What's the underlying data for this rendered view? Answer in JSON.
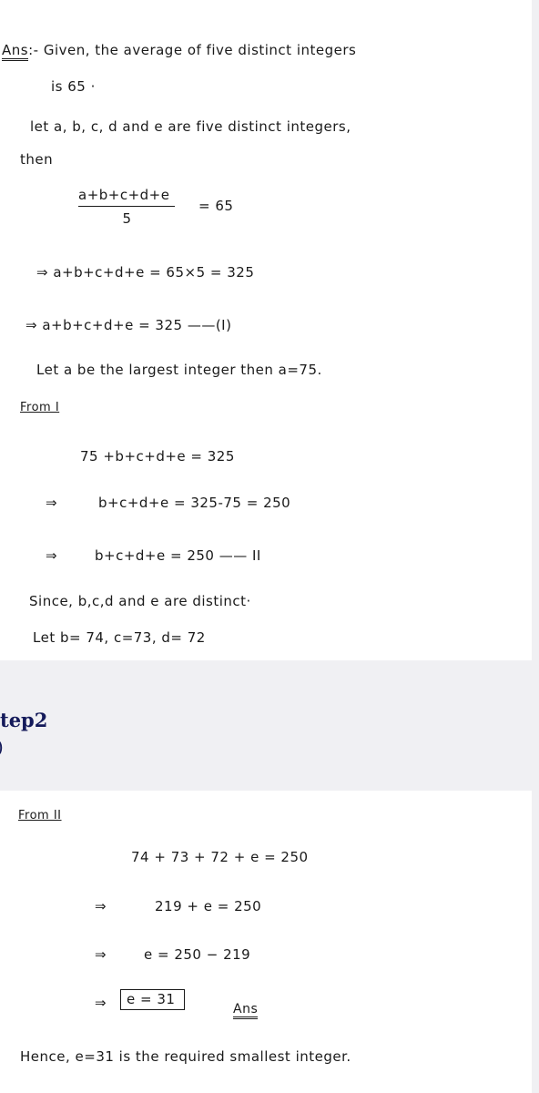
{
  "step_header": {
    "label": "tep2",
    "paren": ")"
  },
  "card1": {
    "ans_label": "Ans",
    "line1": ":- Given, the average of five distinct integers",
    "line2": "is 65 ·",
    "line3": "let a, b, c, d and e are five distinct integers,",
    "line4": "then",
    "fraction": {
      "numerator": "a+b+c+d+e",
      "denominator": "5",
      "rhs": "= 65"
    },
    "eq1": "⇒ a+b+c+d+e = 65×5 = 325",
    "eq2": "⇒ a+b+c+d+e = 325 ——(I)",
    "line5": "Let a be the largest integer then a=75.",
    "from_label": "From I",
    "eq3": "75 +b+c+d+e = 325",
    "eq4_arrow": "⇒",
    "eq4": "b+c+d+e = 325-75 = 250",
    "eq5_arrow": "⇒",
    "eq5": "b+c+d+e = 250 —— II",
    "line6": "Since, b,c,d and e are distinct·",
    "line7": "Let  b= 74, c=73, d= 72"
  },
  "card2": {
    "from_label": "From II",
    "eq1": "74 + 73 + 72 + e = 250",
    "eq2_arrow": "⇒",
    "eq2": "219 + e = 250",
    "eq3_arrow": "⇒",
    "eq3": "e = 250 − 219",
    "eq4_arrow": "⇒",
    "eq4_boxed": "e = 31",
    "ans_mark": "Ans",
    "conclusion": "Hence, e=31 is the required smallest integer."
  }
}
